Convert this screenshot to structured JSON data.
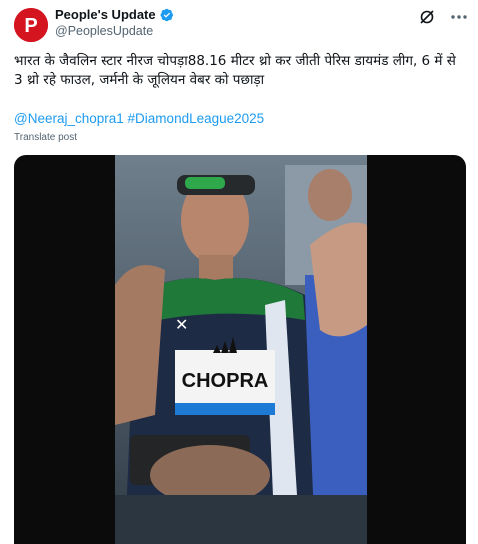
{
  "account": {
    "name": "People's Update",
    "handle": "@PeoplesUpdate",
    "avatar_letter": "P",
    "brand_color": "#d4141e",
    "verified_color": "#1d9bf0"
  },
  "post": {
    "text": "भारत के जैवलिन स्टार नीरज चोपड़ा88.16 मीटर थ्रो कर जीती पेरिस डायमंड लीग, 6 में से 3 थ्रो रहे फाउल,  जर्मनी के जूलियन वेबर को पछाड़ा",
    "mention": "@Neeraj_chopra1",
    "hashtag": "#DiamondLeague2025",
    "translate_label": "Translate post",
    "link_color": "#1d9bf0"
  },
  "icons": {
    "grok": "grok-icon",
    "more": "more-options-icon"
  },
  "media": {
    "type": "video",
    "bib_text": "CHOPRA"
  }
}
